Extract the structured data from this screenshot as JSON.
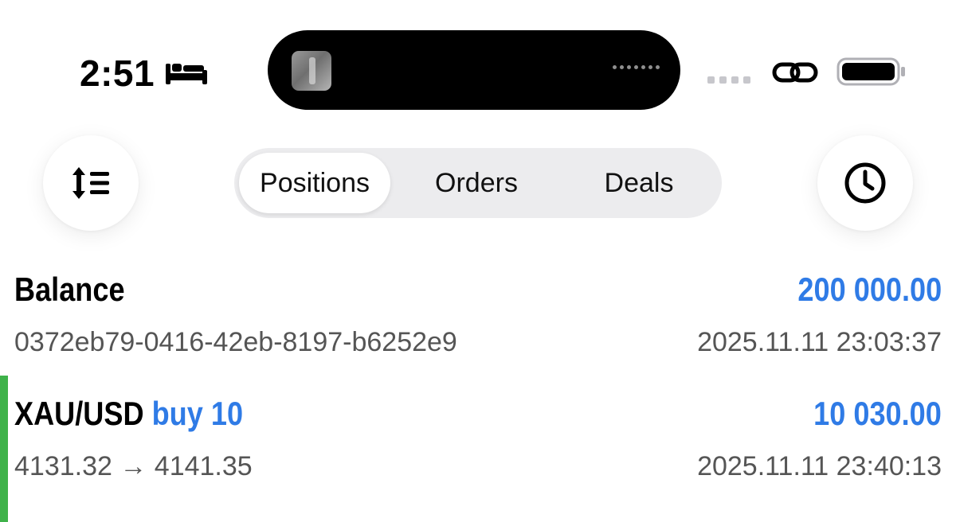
{
  "status_bar": {
    "time": "2:51",
    "focus_icon": "bed-icon",
    "connection_icon": "link-icon",
    "battery_icon": "battery-icon"
  },
  "toolbar": {
    "sort_icon": "sort-lines-icon",
    "history_icon": "clock-icon",
    "tabs": [
      {
        "label": "Positions",
        "active": true
      },
      {
        "label": "Orders",
        "active": false
      },
      {
        "label": "Deals",
        "active": false
      }
    ]
  },
  "rows": {
    "balance": {
      "title": "Balance",
      "amount": "200 000.00",
      "id": "0372eb79-0416-42eb-8197-b6252e9",
      "timestamp": "2025.11.11 23:03:37"
    },
    "position": {
      "symbol": "XAU/USD",
      "direction": "buy 10",
      "amount": "10 030.00",
      "prices": "4131.32 → 4141.35",
      "timestamp": "2025.11.11 23:40:13"
    }
  },
  "colors": {
    "accent_blue": "#2f7be6",
    "profit_green": "#3fb24a",
    "segment_bg": "#ececee"
  }
}
